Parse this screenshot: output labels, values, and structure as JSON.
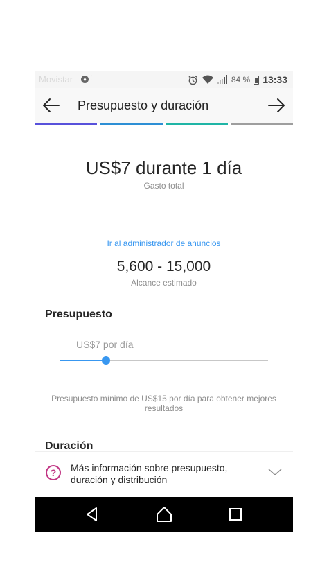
{
  "status_bar": {
    "carrier": "Movistar",
    "battery_percent": "84 %",
    "time": "13:33"
  },
  "header": {
    "title": "Presupuesto y duración"
  },
  "progress": {
    "colors": [
      "#5851db",
      "#2d8fd5",
      "#1fb5a6",
      "#9e9e9e"
    ]
  },
  "summary": {
    "amount": "US$7 durante 1 día",
    "amount_label": "Gasto total"
  },
  "ads_manager_link": "Ir al administrador de anuncios",
  "reach": {
    "value": "5,600 - 15,000",
    "label": "Alcance estimado"
  },
  "budget": {
    "heading": "Presupuesto",
    "value_label": "US$7 por día",
    "slider_fraction": 0.22,
    "hint": "Presupuesto mínimo de US$15 por día para obtener mejores resultados"
  },
  "duration": {
    "heading": "Duración"
  },
  "info": {
    "text": "Más información sobre presupuesto, duración y distribución"
  }
}
